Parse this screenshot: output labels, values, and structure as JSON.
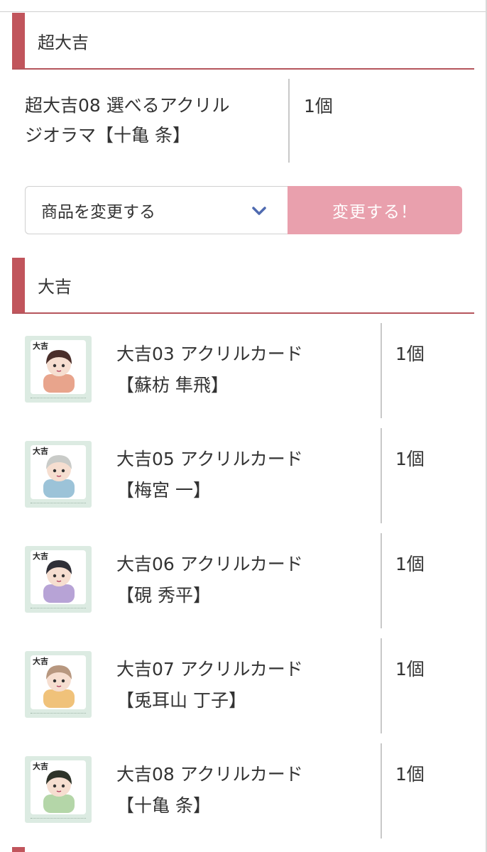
{
  "colors": {
    "accent": "#c1555c",
    "button": "#e9a0ad",
    "chevron": "#4f6ab0",
    "thumb_bg": "#dcebe2"
  },
  "sections": {
    "super_daikichi": {
      "title": "超大吉",
      "item": {
        "name_line1": "超大吉08 選べるアクリル",
        "name_line2": "ジオラマ【十亀 条】",
        "quantity": "1個"
      },
      "select": {
        "value": "商品を変更する",
        "icon": "chevron-down-icon"
      },
      "change_button_label": "変更する！"
    },
    "daikichi": {
      "title": "大吉",
      "items": [
        {
          "name_line1": "大吉03 アクリルカード",
          "name_line2": "【蘇枋 隼飛】",
          "quantity": "1個",
          "badge": "大吉",
          "hair": "#4a2e2a",
          "outfit": "#e8a48c"
        },
        {
          "name_line1": "大吉05 アクリルカード",
          "name_line2": "【梅宮 一】",
          "quantity": "1個",
          "badge": "大吉",
          "hair": "#c9cbc8",
          "outfit": "#9cc3d8"
        },
        {
          "name_line1": "大吉06 アクリルカード",
          "name_line2": "【硯 秀平】",
          "quantity": "1個",
          "badge": "大吉",
          "hair": "#2f2f37",
          "outfit": "#b7a3d6"
        },
        {
          "name_line1": "大吉07 アクリルカード",
          "name_line2": "【兎耳山 丁子】",
          "quantity": "1個",
          "badge": "大吉",
          "hair": "#b7977f",
          "outfit": "#f0c27a"
        },
        {
          "name_line1": "大吉08 アクリルカード",
          "name_line2": "【十亀 条】",
          "quantity": "1個",
          "badge": "大吉",
          "hair": "#2e3329",
          "outfit": "#b4d6a8"
        }
      ]
    }
  }
}
